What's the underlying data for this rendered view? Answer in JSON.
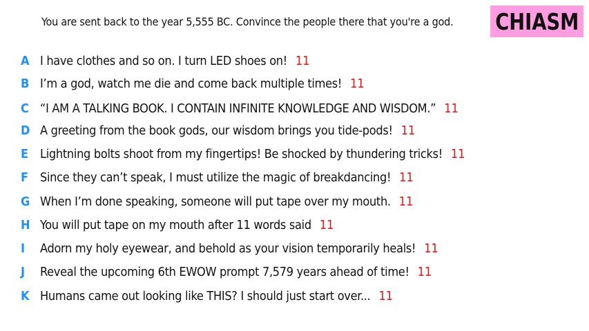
{
  "prompt": "You are sent back to the year 5,555 BC. Convince the people there that you're a god.",
  "badge": "CHIASM",
  "entries": [
    {
      "letter": "A",
      "text": "I have clothes and so on. I turn LED shoes on!",
      "count": "11"
    },
    {
      "letter": "B",
      "text": "I’m a god, watch me die and come back multiple times!",
      "count": "11"
    },
    {
      "letter": "C",
      "text": "“I AM A TALKING BOOK. I CONTAIN INFINITE KNOWLEDGE AND WISDOM.”",
      "count": "11"
    },
    {
      "letter": "D",
      "text": "A greeting from the book gods, our wisdom brings you tide-pods!",
      "count": "11"
    },
    {
      "letter": "E",
      "text": "Lightning bolts shoot from my fingertips! Be shocked by thundering tricks!",
      "count": "11"
    },
    {
      "letter": "F",
      "text": "Since they can’t speak, I must utilize the magic of breakdancing!",
      "count": "11"
    },
    {
      "letter": "G",
      "text": "When I’m done speaking, someone will put tape over my mouth.",
      "count": "11"
    },
    {
      "letter": "H",
      "text": "You will put tape on my mouth after 11 words said",
      "count": "11"
    },
    {
      "letter": "I",
      "text": "Adorn my holy eyewear, and behold as your vision temporarily heals!",
      "count": "11"
    },
    {
      "letter": "J",
      "text": "Reveal the upcoming 6th EWOW prompt 7,579 years ahead of time!",
      "count": "11"
    },
    {
      "letter": "K",
      "text": "Humans came out looking like THIS? I should just start over...",
      "count": "11"
    }
  ],
  "colors": {
    "letter": "#1e90ff",
    "count": "#ee1111",
    "badge_bg": "#ff9de0",
    "text": "#111111"
  }
}
